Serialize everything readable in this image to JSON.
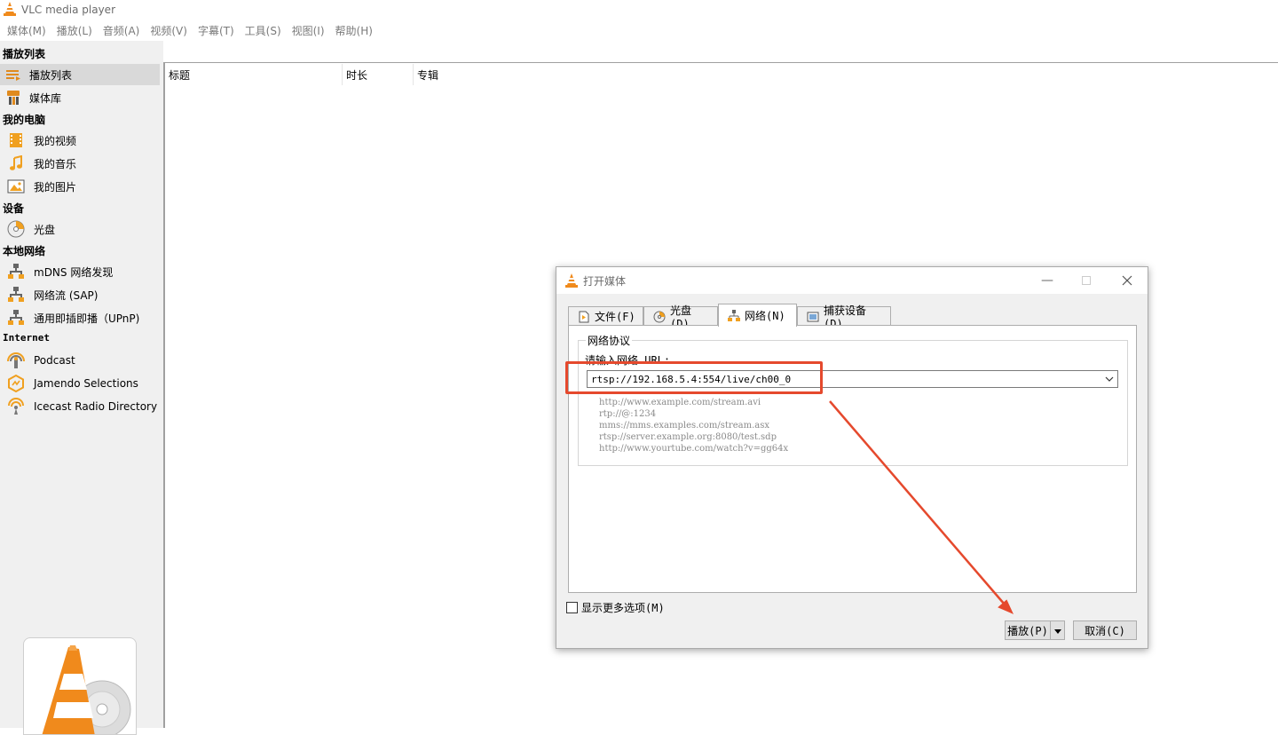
{
  "window": {
    "title": "VLC media player"
  },
  "menu": {
    "items": [
      "媒体(M)",
      "播放(L)",
      "音频(A)",
      "视频(V)",
      "字幕(T)",
      "工具(S)",
      "视图(I)",
      "帮助(H)"
    ]
  },
  "sidebar": {
    "sections": {
      "playlist": "播放列表",
      "my_computer": "我的电脑",
      "devices": "设备",
      "local_network": "本地网络",
      "internet": "Internet"
    },
    "items": {
      "playlist": "播放列表",
      "library": "媒体库",
      "videos": "我的视频",
      "music": "我的音乐",
      "pictures": "我的图片",
      "disc": "光盘",
      "mdns": "mDNS 网络发现",
      "sap": "网络流 (SAP)",
      "upnp": "通用即插即播（UPnP)",
      "podcast": "Podcast",
      "jamendo": "Jamendo Selections",
      "icecast": "Icecast Radio Directory"
    }
  },
  "playlist": {
    "columns": [
      "标题",
      "时长",
      "专辑"
    ]
  },
  "dialog": {
    "title": "打开媒体",
    "tabs": [
      "文件(F)",
      "光盘(D)",
      "网络(N)",
      "捕获设备(D)"
    ],
    "active_tab": "网络(N)",
    "group_title": "网络协议",
    "url_label": "请输入网络 URL:",
    "url_value": "rtsp://192.168.5.4:554/live/ch00_0",
    "examples": [
      "http://www.example.com/stream.avi",
      "rtp://@:1234",
      "mms://mms.examples.com/stream.asx",
      "rtsp://server.example.org:8080/test.sdp",
      "http://www.yourtube.com/watch?v=gg64x"
    ],
    "more_options": "显示更多选项(M)",
    "more_options_checked": false,
    "play_button": "播放(P)",
    "cancel_button": "取消(C)"
  },
  "annotation": {
    "color": "#e5492d"
  }
}
